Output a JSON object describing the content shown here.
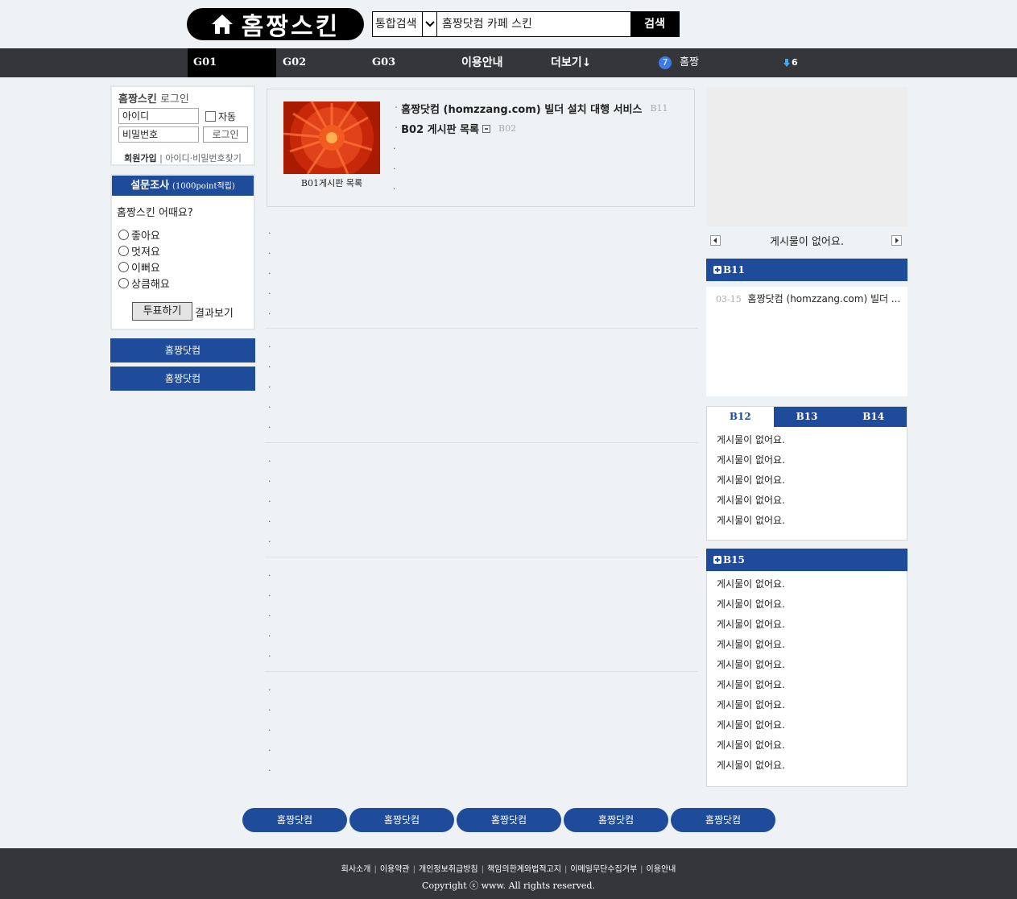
{
  "header": {
    "logo_text": "홈짱스킨",
    "search": {
      "scope": "통합검색",
      "query": "홈짱닷컴 카페 스킨",
      "button": "검색"
    }
  },
  "nav": {
    "items": [
      "G01",
      "G02",
      "G03",
      "이용안내",
      "더보기↓"
    ],
    "active": "G01",
    "home_badge": "7",
    "home_label": "홈짱",
    "down_count": "6"
  },
  "login": {
    "title_brand": "홈짱스킨",
    "title_rest": " 로그인",
    "id_placeholder": "아이디",
    "pw_placeholder": "비밀번호",
    "auto_label": "자동",
    "button": "로그인",
    "join": "회원가입",
    "sep": "|",
    "find": "아이디·비밀번호찾기"
  },
  "survey": {
    "title": "설문조사",
    "reward": "(1000point적립)",
    "question": "홈짱스킨 어때요?",
    "options": [
      "좋아요",
      "멋져요",
      "이뻐요",
      "상큼해요"
    ],
    "vote_button": "투표하기",
    "results_link": "결과보기"
  },
  "left_buttons": [
    "홈짱닷컴",
    "홈짱닷컴"
  ],
  "featured": {
    "caption": "B01게시판 목록",
    "lines": [
      {
        "text": "홈짱닷컴 (homzzang.com) 빌더 설치 대행 서비스",
        "code": "B11"
      },
      {
        "text": "B02 게시판 목록",
        "code": "B02"
      }
    ],
    "empty_dots": [
      ".",
      ".",
      "."
    ]
  },
  "center_blocks": [
    [
      ".",
      ".",
      ".",
      ".",
      "."
    ],
    [
      ".",
      ".",
      ".",
      ".",
      "."
    ],
    [
      ".",
      ".",
      ".",
      ".",
      "."
    ],
    [
      ".",
      ".",
      ".",
      ".",
      "."
    ],
    [
      ".",
      ".",
      ".",
      ".",
      "."
    ]
  ],
  "right": {
    "slider_text": "게시물이 없어요.",
    "b11": {
      "title": "B11",
      "items": [
        {
          "date": "03-15",
          "text": "홈짱닷컴 (homzzang.com) 빌더 ..."
        }
      ]
    },
    "tabs": {
      "labels": [
        "B12",
        "B13",
        "B14"
      ],
      "active": "B12",
      "rows": [
        "게시물이 없어요.",
        "게시물이 없어요.",
        "게시물이 없어요.",
        "게시물이 없어요.",
        "게시물이 없어요."
      ]
    },
    "b15": {
      "title": "B15",
      "rows": [
        "게시물이 없어요.",
        "게시물이 없어요.",
        "게시물이 없어요.",
        "게시물이 없어요.",
        "게시물이 없어요.",
        "게시물이 없어요.",
        "게시물이 없어요.",
        "게시물이 없어요.",
        "게시물이 없어요.",
        "게시물이 없어요."
      ]
    }
  },
  "bottom_buttons": [
    "홈짱닷컴",
    "홈짱닷컴",
    "홈짱닷컴",
    "홈짱닷컴",
    "홈짱닷컴"
  ],
  "footer": {
    "links": [
      "회사소개",
      "이용약관",
      "개인정보취급방침",
      "책임의한계와법적고지",
      "이메일무단수집거부",
      "이용안내"
    ],
    "separator": "|",
    "copyright": "Copyright ⓒ www. All rights reserved."
  },
  "colors": {
    "brand_blue": "#1f4b9b",
    "nav_bg": "#35363a",
    "page_bg": "#eff2f4"
  }
}
